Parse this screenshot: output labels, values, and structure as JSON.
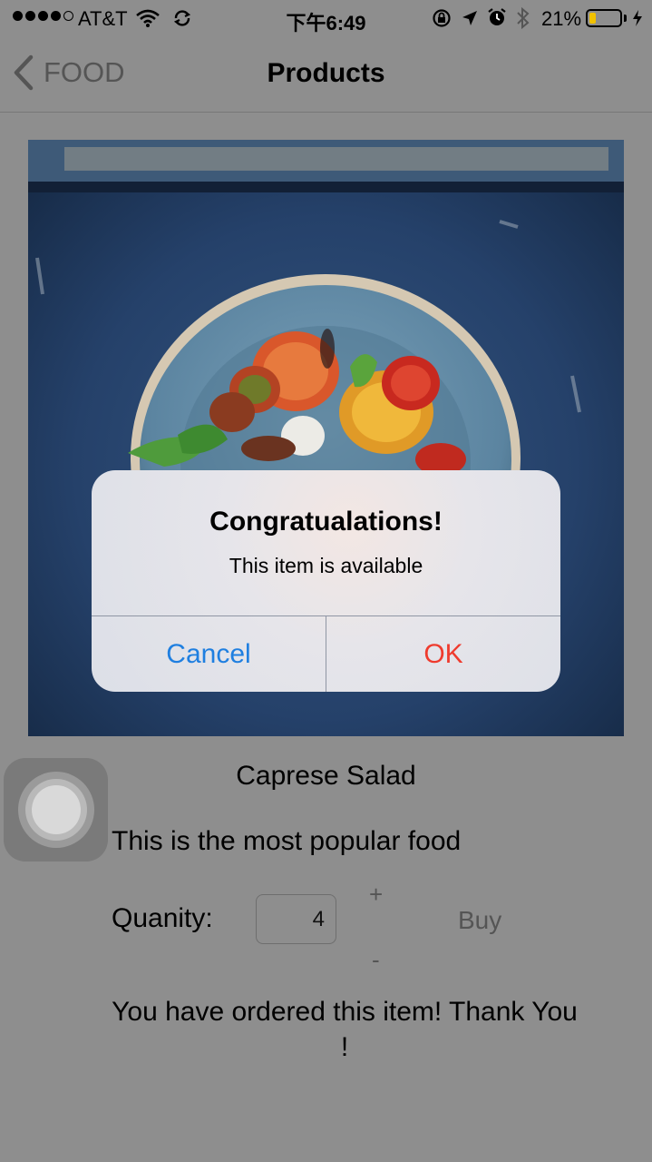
{
  "status_bar": {
    "carrier": "AT&T",
    "time": "下午6:49",
    "battery_percent": "21%",
    "battery_level": 0.21,
    "icons": [
      "wifi-icon",
      "sync-icon",
      "rotation-lock-icon",
      "location-arrow-icon",
      "alarm-icon",
      "bluetooth-icon",
      "charging-bolt-icon"
    ]
  },
  "nav": {
    "back_label": "FOOD",
    "title": "Products"
  },
  "product": {
    "name": "Caprese Salad",
    "description": "This is the most popular food",
    "quantity_label": "Quanity:",
    "quantity_value": "4",
    "plus_label": "+",
    "minus_label": "-",
    "buy_label": "Buy",
    "confirmation": "You have ordered this item! Thank You !"
  },
  "alert": {
    "title": "Congratualations!",
    "message": "This item is available",
    "cancel_label": "Cancel",
    "ok_label": "OK"
  },
  "colors": {
    "cancel": "#1f7fe0",
    "ok": "#ef3b2e",
    "battery": "#f2c200"
  }
}
